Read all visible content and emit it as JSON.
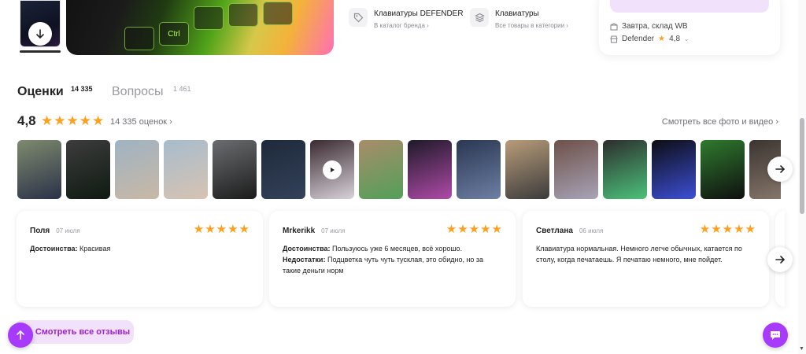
{
  "brand_links": [
    {
      "title": "Клавиатуры DEFENDER",
      "subtitle": "В каталог бренда ›",
      "icon": "tag-icon"
    },
    {
      "title": "Клавиатуры",
      "subtitle": "Все товары в категории ›",
      "icon": "layers-icon"
    }
  ],
  "purchase": {
    "delivery": "Завтра, склад WB",
    "seller": "Defender",
    "seller_rating": "4,8"
  },
  "tabs": {
    "ratings_label": "Оценки",
    "ratings_count": "14 335",
    "questions_label": "Вопросы",
    "questions_count": "1 461"
  },
  "summary": {
    "rating": "4,8",
    "stars": 5,
    "count_text": "14 335 оценок ›",
    "see_all_media": "Смотреть все фото и видео ›"
  },
  "photos": [
    {
      "c1": "#7f8a6e",
      "c2": "#2a3148"
    },
    {
      "c1": "#3c3c3c",
      "c2": "#0f1a12"
    },
    {
      "c1": "#9fb3c2",
      "c2": "#c9b8a6"
    },
    {
      "c1": "#a7bccd",
      "c2": "#d7c3b2"
    },
    {
      "c1": "#6a6d70",
      "c2": "#1b1b1b"
    },
    {
      "c1": "#1e2a3a",
      "c2": "#33415a"
    },
    {
      "c1": "#3a2a30",
      "c2": "#d9d2da",
      "video": true
    },
    {
      "c1": "#a98c6a",
      "c2": "#52a05a"
    },
    {
      "c1": "#1d1a28",
      "c2": "#b04aa8"
    },
    {
      "c1": "#2a3752",
      "c2": "#6d7fa3"
    },
    {
      "c1": "#b89c7a",
      "c2": "#3b3b3b"
    },
    {
      "c1": "#6d5048",
      "c2": "#a8a4b8"
    },
    {
      "c1": "#2d2d2d",
      "c2": "#4bc27a"
    },
    {
      "c1": "#0d0d12",
      "c2": "#3c4fd6"
    },
    {
      "c1": "#2f7a2f",
      "c2": "#0f0f0f"
    },
    {
      "c1": "#3a3430",
      "c2": "#8a7a6e"
    }
  ],
  "reviews": [
    {
      "name": "Поля",
      "date": "07 июля",
      "stars": 5,
      "lines": [
        {
          "label": "Достоинства:",
          "text": "Красивая"
        }
      ]
    },
    {
      "name": "Mrkerikk",
      "date": "07 июля",
      "stars": 5,
      "lines": [
        {
          "label": "Достоинства:",
          "text": "Пользуюсь уже 6 месяцев, всё хорошо."
        },
        {
          "label": "Недостатки:",
          "text": "Подцветка чуть чуть тусклая, это обидно, но за такие деньги норм"
        }
      ]
    },
    {
      "name": "Светлана",
      "date": "06 июля",
      "stars": 5,
      "lines": [
        {
          "label": "",
          "text": "Клавиатура нормальная. Немного легче обычных, катается по столу, когда печатаешь. Я печатаю немного, мне пойдет."
        }
      ]
    }
  ],
  "see_all_reviews": "Смотреть все отзывы",
  "colors": {
    "accent": "#a73afd",
    "accent_soft": "#f1e1fb",
    "star": "#ff9f1c"
  }
}
